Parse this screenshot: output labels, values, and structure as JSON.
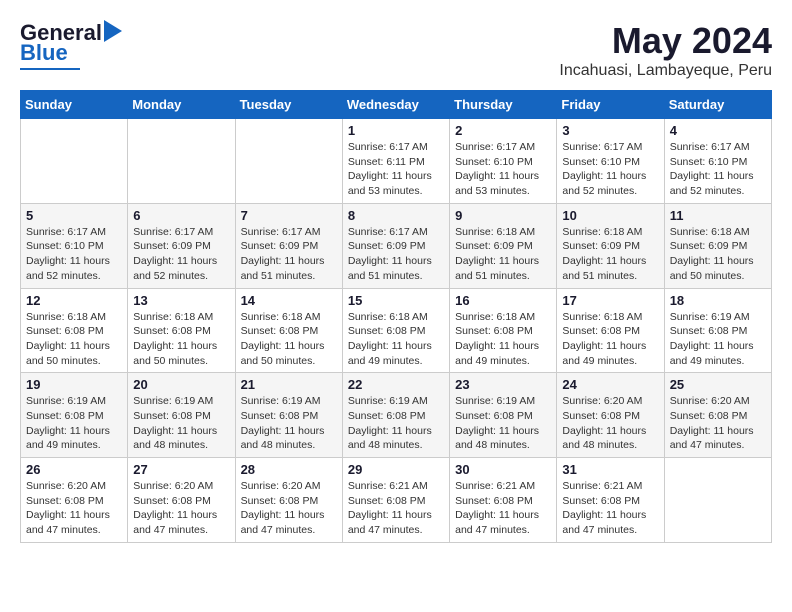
{
  "header": {
    "logo_general": "General",
    "logo_blue": "Blue",
    "month": "May 2024",
    "location": "Incahuasi, Lambayeque, Peru"
  },
  "weekdays": [
    "Sunday",
    "Monday",
    "Tuesday",
    "Wednesday",
    "Thursday",
    "Friday",
    "Saturday"
  ],
  "weeks": [
    [
      {
        "day": "",
        "info": ""
      },
      {
        "day": "",
        "info": ""
      },
      {
        "day": "",
        "info": ""
      },
      {
        "day": "1",
        "info": "Sunrise: 6:17 AM\nSunset: 6:11 PM\nDaylight: 11 hours and 53 minutes."
      },
      {
        "day": "2",
        "info": "Sunrise: 6:17 AM\nSunset: 6:10 PM\nDaylight: 11 hours and 53 minutes."
      },
      {
        "day": "3",
        "info": "Sunrise: 6:17 AM\nSunset: 6:10 PM\nDaylight: 11 hours and 52 minutes."
      },
      {
        "day": "4",
        "info": "Sunrise: 6:17 AM\nSunset: 6:10 PM\nDaylight: 11 hours and 52 minutes."
      }
    ],
    [
      {
        "day": "5",
        "info": "Sunrise: 6:17 AM\nSunset: 6:10 PM\nDaylight: 11 hours and 52 minutes."
      },
      {
        "day": "6",
        "info": "Sunrise: 6:17 AM\nSunset: 6:09 PM\nDaylight: 11 hours and 52 minutes."
      },
      {
        "day": "7",
        "info": "Sunrise: 6:17 AM\nSunset: 6:09 PM\nDaylight: 11 hours and 51 minutes."
      },
      {
        "day": "8",
        "info": "Sunrise: 6:17 AM\nSunset: 6:09 PM\nDaylight: 11 hours and 51 minutes."
      },
      {
        "day": "9",
        "info": "Sunrise: 6:18 AM\nSunset: 6:09 PM\nDaylight: 11 hours and 51 minutes."
      },
      {
        "day": "10",
        "info": "Sunrise: 6:18 AM\nSunset: 6:09 PM\nDaylight: 11 hours and 51 minutes."
      },
      {
        "day": "11",
        "info": "Sunrise: 6:18 AM\nSunset: 6:09 PM\nDaylight: 11 hours and 50 minutes."
      }
    ],
    [
      {
        "day": "12",
        "info": "Sunrise: 6:18 AM\nSunset: 6:08 PM\nDaylight: 11 hours and 50 minutes."
      },
      {
        "day": "13",
        "info": "Sunrise: 6:18 AM\nSunset: 6:08 PM\nDaylight: 11 hours and 50 minutes."
      },
      {
        "day": "14",
        "info": "Sunrise: 6:18 AM\nSunset: 6:08 PM\nDaylight: 11 hours and 50 minutes."
      },
      {
        "day": "15",
        "info": "Sunrise: 6:18 AM\nSunset: 6:08 PM\nDaylight: 11 hours and 49 minutes."
      },
      {
        "day": "16",
        "info": "Sunrise: 6:18 AM\nSunset: 6:08 PM\nDaylight: 11 hours and 49 minutes."
      },
      {
        "day": "17",
        "info": "Sunrise: 6:18 AM\nSunset: 6:08 PM\nDaylight: 11 hours and 49 minutes."
      },
      {
        "day": "18",
        "info": "Sunrise: 6:19 AM\nSunset: 6:08 PM\nDaylight: 11 hours and 49 minutes."
      }
    ],
    [
      {
        "day": "19",
        "info": "Sunrise: 6:19 AM\nSunset: 6:08 PM\nDaylight: 11 hours and 49 minutes."
      },
      {
        "day": "20",
        "info": "Sunrise: 6:19 AM\nSunset: 6:08 PM\nDaylight: 11 hours and 48 minutes."
      },
      {
        "day": "21",
        "info": "Sunrise: 6:19 AM\nSunset: 6:08 PM\nDaylight: 11 hours and 48 minutes."
      },
      {
        "day": "22",
        "info": "Sunrise: 6:19 AM\nSunset: 6:08 PM\nDaylight: 11 hours and 48 minutes."
      },
      {
        "day": "23",
        "info": "Sunrise: 6:19 AM\nSunset: 6:08 PM\nDaylight: 11 hours and 48 minutes."
      },
      {
        "day": "24",
        "info": "Sunrise: 6:20 AM\nSunset: 6:08 PM\nDaylight: 11 hours and 48 minutes."
      },
      {
        "day": "25",
        "info": "Sunrise: 6:20 AM\nSunset: 6:08 PM\nDaylight: 11 hours and 47 minutes."
      }
    ],
    [
      {
        "day": "26",
        "info": "Sunrise: 6:20 AM\nSunset: 6:08 PM\nDaylight: 11 hours and 47 minutes."
      },
      {
        "day": "27",
        "info": "Sunrise: 6:20 AM\nSunset: 6:08 PM\nDaylight: 11 hours and 47 minutes."
      },
      {
        "day": "28",
        "info": "Sunrise: 6:20 AM\nSunset: 6:08 PM\nDaylight: 11 hours and 47 minutes."
      },
      {
        "day": "29",
        "info": "Sunrise: 6:21 AM\nSunset: 6:08 PM\nDaylight: 11 hours and 47 minutes."
      },
      {
        "day": "30",
        "info": "Sunrise: 6:21 AM\nSunset: 6:08 PM\nDaylight: 11 hours and 47 minutes."
      },
      {
        "day": "31",
        "info": "Sunrise: 6:21 AM\nSunset: 6:08 PM\nDaylight: 11 hours and 47 minutes."
      },
      {
        "day": "",
        "info": ""
      }
    ]
  ]
}
